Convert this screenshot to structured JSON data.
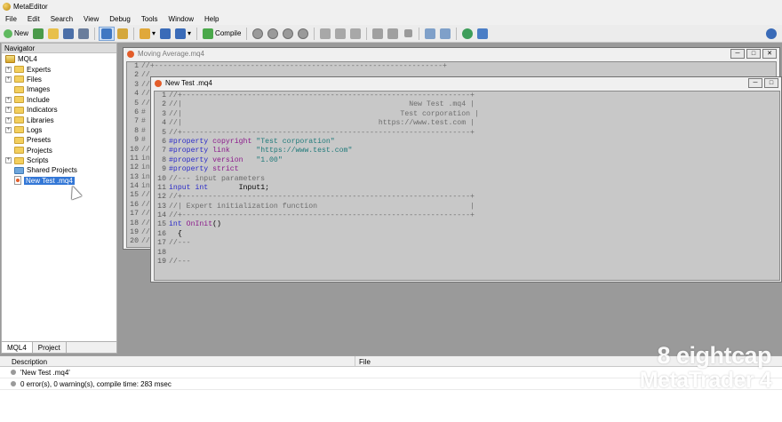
{
  "app": {
    "title": "MetaEditor"
  },
  "menu": [
    "File",
    "Edit",
    "Search",
    "View",
    "Debug",
    "Tools",
    "Window",
    "Help"
  ],
  "toolbar": {
    "new_label": "New",
    "compile_label": "Compile"
  },
  "navigator": {
    "title": "Navigator",
    "root": "MQL4",
    "items": [
      {
        "label": "Experts",
        "type": "folder",
        "expandable": true
      },
      {
        "label": "Files",
        "type": "folder",
        "expandable": true
      },
      {
        "label": "Images",
        "type": "folder",
        "expandable": false
      },
      {
        "label": "Include",
        "type": "folder",
        "expandable": true
      },
      {
        "label": "Indicators",
        "type": "folder",
        "expandable": true
      },
      {
        "label": "Libraries",
        "type": "folder",
        "expandable": true
      },
      {
        "label": "Logs",
        "type": "folder",
        "expandable": true
      },
      {
        "label": "Presets",
        "type": "folder",
        "expandable": false
      },
      {
        "label": "Projects",
        "type": "folder",
        "expandable": false
      },
      {
        "label": "Scripts",
        "type": "folder",
        "expandable": true
      },
      {
        "label": "Shared Projects",
        "type": "shared-folder",
        "expandable": false
      },
      {
        "label": "New Test .mq4",
        "type": "file",
        "expandable": false,
        "selected": true
      }
    ],
    "tabs": [
      "MQL4",
      "Project"
    ]
  },
  "background_window": {
    "title": "Moving Average.mq4",
    "line_numbers": [
      "1",
      "2",
      "3",
      "4",
      "5",
      "6",
      "7",
      "8",
      "9",
      "10",
      "11",
      "12",
      "13",
      "14",
      "15",
      "16",
      "17",
      "18",
      "19",
      "20"
    ],
    "visible_fragments": [
      "//+------------------------------------------------------------------+",
      "//",
      "//",
      "//",
      "//",
      "#",
      "#",
      "#",
      "#",
      "//",
      "in",
      "in",
      "in",
      "in",
      "//",
      "//",
      "//",
      "//",
      "//",
      "//"
    ]
  },
  "editor": {
    "title": "New Test .mq4",
    "lines": [
      {
        "n": "1",
        "parts": [
          {
            "t": "//+------------------------------------------------------------------+",
            "c": "cm"
          }
        ]
      },
      {
        "n": "2",
        "parts": [
          {
            "t": "//|                                                    New Test .mq4 |",
            "c": "cm"
          }
        ]
      },
      {
        "n": "3",
        "parts": [
          {
            "t": "//|                                                  Test corporation |",
            "c": "cm"
          }
        ]
      },
      {
        "n": "4",
        "parts": [
          {
            "t": "//|                                             https://www.test.com |",
            "c": "cm"
          }
        ]
      },
      {
        "n": "5",
        "parts": [
          {
            "t": "//+------------------------------------------------------------------+",
            "c": "cm"
          }
        ]
      },
      {
        "n": "6",
        "parts": [
          {
            "t": "#property ",
            "c": "prop"
          },
          {
            "t": "copyright ",
            "c": "kw2"
          },
          {
            "t": "\"Test corporation\"",
            "c": "str"
          }
        ]
      },
      {
        "n": "7",
        "parts": [
          {
            "t": "#property ",
            "c": "prop"
          },
          {
            "t": "link      ",
            "c": "kw2"
          },
          {
            "t": "\"https://www.test.com\"",
            "c": "str"
          }
        ]
      },
      {
        "n": "8",
        "parts": [
          {
            "t": "#property ",
            "c": "prop"
          },
          {
            "t": "version   ",
            "c": "kw2"
          },
          {
            "t": "\"1.00\"",
            "c": "str"
          }
        ]
      },
      {
        "n": "9",
        "parts": [
          {
            "t": "#property ",
            "c": "prop"
          },
          {
            "t": "strict",
            "c": "kw2"
          }
        ]
      },
      {
        "n": "10",
        "parts": [
          {
            "t": "//--- input parameters",
            "c": "cm"
          }
        ]
      },
      {
        "n": "11",
        "parts": [
          {
            "t": "input ",
            "c": "kw"
          },
          {
            "t": "int       ",
            "c": "kw"
          },
          {
            "t": "Input1;",
            "c": "txt"
          }
        ]
      },
      {
        "n": "12",
        "parts": [
          {
            "t": "//+------------------------------------------------------------------+",
            "c": "cm"
          }
        ]
      },
      {
        "n": "13",
        "parts": [
          {
            "t": "//| Expert initialization function                                   |",
            "c": "cm"
          }
        ]
      },
      {
        "n": "14",
        "parts": [
          {
            "t": "//+------------------------------------------------------------------+",
            "c": "cm"
          }
        ]
      },
      {
        "n": "15",
        "parts": [
          {
            "t": "int ",
            "c": "kw"
          },
          {
            "t": "OnInit",
            "c": "kw2"
          },
          {
            "t": "()",
            "c": "txt"
          }
        ]
      },
      {
        "n": "16",
        "parts": [
          {
            "t": "  {",
            "c": "txt"
          }
        ]
      },
      {
        "n": "17",
        "parts": [
          {
            "t": "//---",
            "c": "cm"
          }
        ]
      },
      {
        "n": "18",
        "parts": [
          {
            "t": "",
            "c": "txt"
          }
        ]
      },
      {
        "n": "19",
        "parts": [
          {
            "t": "//---",
            "c": "cm"
          }
        ]
      }
    ]
  },
  "bottom": {
    "col_description": "Description",
    "col_file": "File",
    "rows": [
      "'New Test .mq4'",
      "0 error(s), 0 warning(s), compile time: 283 msec"
    ]
  },
  "watermark": {
    "brand": "eightcap",
    "product": "MetaTrader 4"
  }
}
